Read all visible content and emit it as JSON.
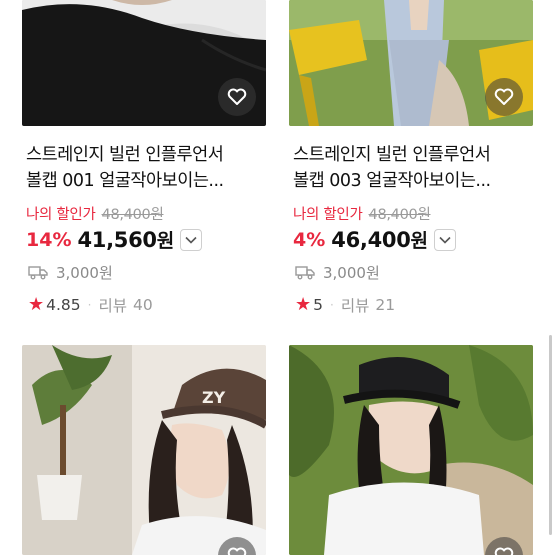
{
  "products": [
    {
      "title_line1": "스트레인지 빌런 인플루언서",
      "title_line2": "볼캡 001 얼굴작아보이는...",
      "my_price_label": "나의 할인가",
      "original_price": "48,400원",
      "discount": "14%",
      "price": "41,560",
      "price_unit": "원",
      "shipping": "3,000원",
      "rating": "4.85",
      "review_label": "리뷰",
      "review_count": "40",
      "image_icon": "black-sweater-photo",
      "wishlist_icon": "heart-icon"
    },
    {
      "title_line1": "스트레인지 빌런 인플루언서",
      "title_line2": "볼캡 003 얼굴작아보이는...",
      "my_price_label": "나의 할인가",
      "original_price": "48,400원",
      "discount": "4%",
      "price": "46,400",
      "price_unit": "원",
      "shipping": "3,000원",
      "rating": "5",
      "review_label": "리뷰",
      "review_count": "21",
      "image_icon": "park-bench-photo",
      "wishlist_icon": "heart-icon"
    },
    {
      "image_icon": "brown-cap-model-photo",
      "wishlist_icon": "heart-icon"
    },
    {
      "image_icon": "black-cap-model-photo",
      "wishlist_icon": "heart-icon"
    }
  ],
  "colors": {
    "accent_red": "#e8283f",
    "text_dark": "#111111",
    "text_gray": "#8a8a8a"
  }
}
